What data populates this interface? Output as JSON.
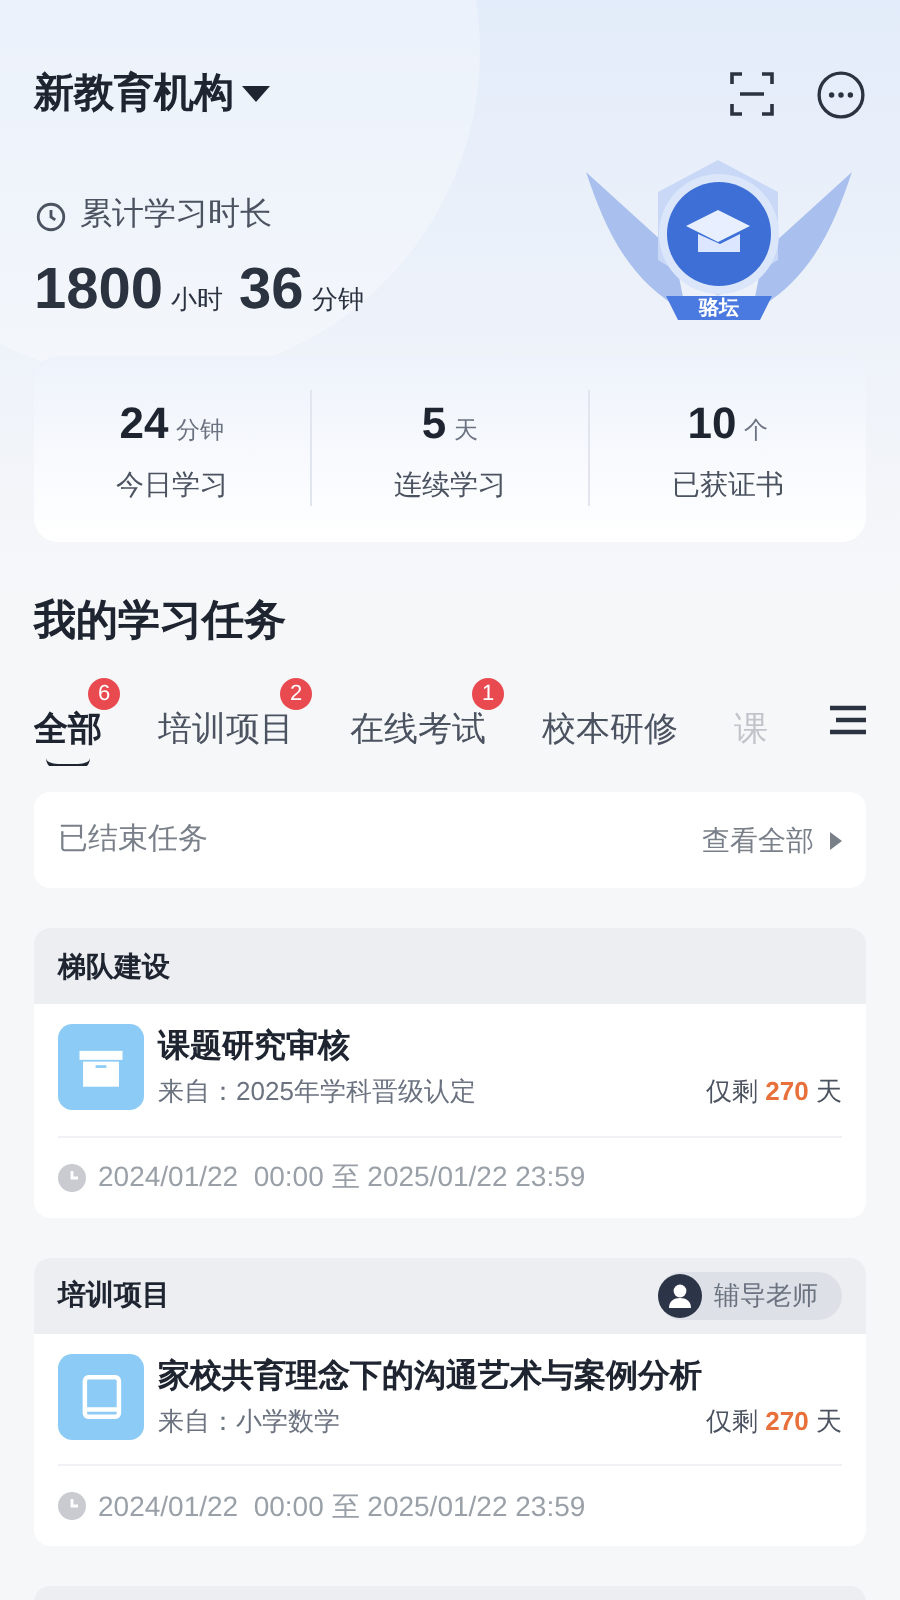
{
  "header": {
    "org": "新教育机构"
  },
  "duration": {
    "label": "累计学习时长",
    "hours": "1800",
    "hours_unit": "小时",
    "minutes": "36",
    "minutes_unit": "分钟",
    "badge": "骆坛"
  },
  "stats": [
    {
      "value": "24",
      "unit": "分钟",
      "label": "今日学习"
    },
    {
      "value": "5",
      "unit": "天",
      "label": "连续学习"
    },
    {
      "value": "10",
      "unit": "个",
      "label": "已获证书"
    }
  ],
  "section_title": "我的学习任务",
  "tabs": [
    {
      "label": "全部",
      "badge": "6",
      "selected": true
    },
    {
      "label": "培训项目",
      "badge": "2",
      "selected": false
    },
    {
      "label": "在线考试",
      "badge": "1",
      "selected": false
    },
    {
      "label": "校本研修",
      "selected": false
    },
    {
      "label": "课",
      "selected": false
    }
  ],
  "ended": {
    "label": "已结束任务",
    "link": "查看全部"
  },
  "tasks": [
    {
      "category": "梯队建设",
      "kind": "box",
      "title": "课题研究审核",
      "source": "来自：2025年学科晋级认定",
      "remain_prefix": "仅剩",
      "remain_days": "270",
      "remain_suffix": "天",
      "period": "2024/01/22  00:00 至 2025/01/22 23:59"
    },
    {
      "category": "培训项目",
      "tutor": "辅导老师",
      "kind": "book",
      "title": "家校共育理念下的沟通艺术与案例分析",
      "source": "来自：小学数学",
      "remain_prefix": "仅剩",
      "remain_days": "270",
      "remain_suffix": "天",
      "period": "2024/01/22  00:00 至 2025/01/22 23:59"
    }
  ]
}
